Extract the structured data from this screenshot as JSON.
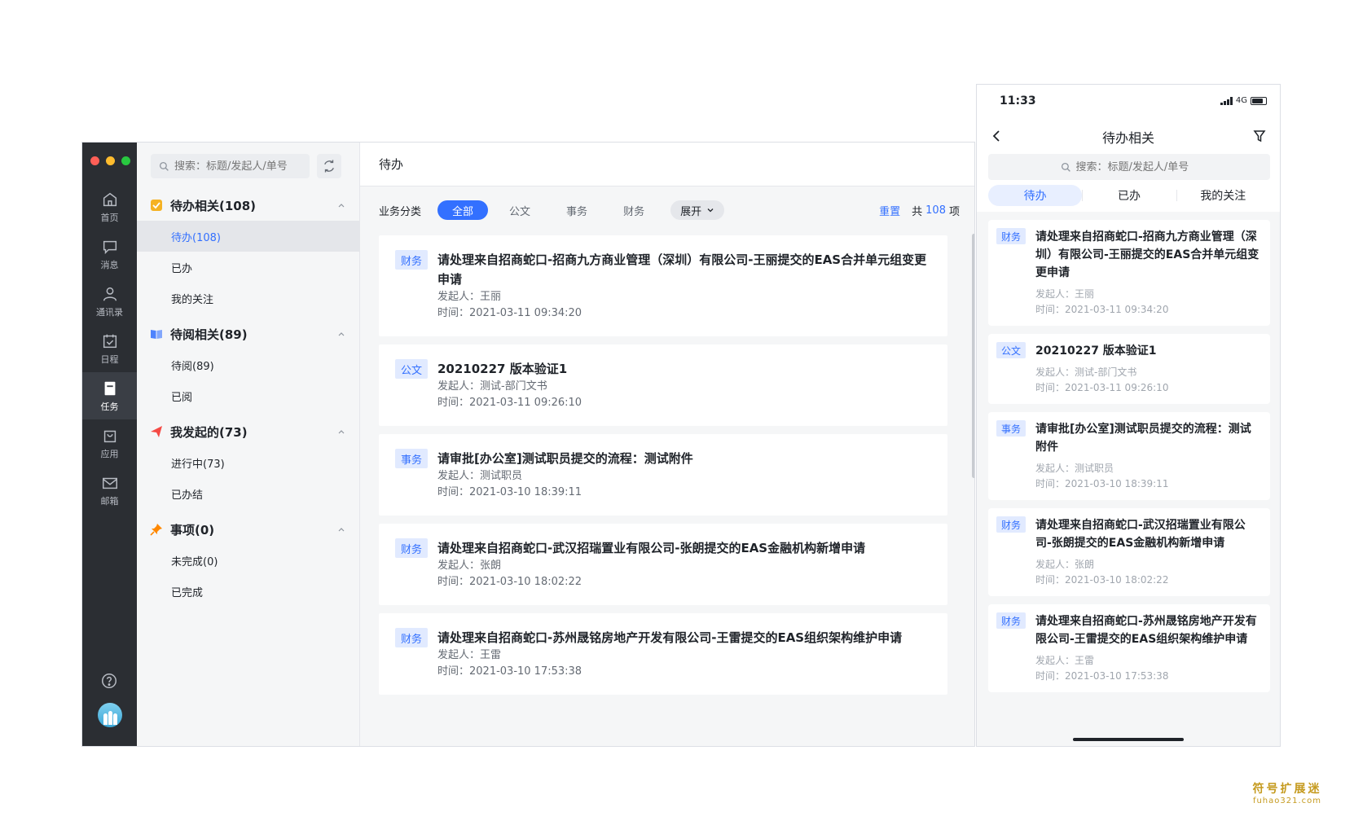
{
  "desktop": {
    "window_controls": {
      "close_color": "#ff5f57",
      "minimize_color": "#febc2e",
      "zoom_color": "#28c840"
    },
    "rail": [
      {
        "label": "首页",
        "icon": "home-icon"
      },
      {
        "label": "消息",
        "icon": "message-icon"
      },
      {
        "label": "通讯录",
        "icon": "contacts-icon"
      },
      {
        "label": "日程",
        "icon": "calendar-icon"
      },
      {
        "label": "任务",
        "icon": "task-icon",
        "active": true
      },
      {
        "label": "应用",
        "icon": "apps-icon"
      },
      {
        "label": "邮箱",
        "icon": "mail-icon"
      }
    ],
    "sidebar": {
      "search_placeholder": "搜索：标题/发起人/单号",
      "groups": [
        {
          "title": "待办相关(108)",
          "icon": "checkbox-icon",
          "items": [
            "待办(108)",
            "已办",
            "我的关注"
          ]
        },
        {
          "title": "待阅相关(89)",
          "icon": "book-icon",
          "items": [
            "待阅(89)",
            "已阅"
          ]
        },
        {
          "title": "我发起的(73)",
          "icon": "send-icon",
          "items": [
            "进行中(73)",
            "已办结"
          ]
        },
        {
          "title": "事项(0)",
          "icon": "pin-icon",
          "items": [
            "未完成(0)",
            "已完成"
          ]
        }
      ]
    },
    "main": {
      "title": "待办",
      "filter_label": "业务分类",
      "chips": [
        "全部",
        "公文",
        "事务",
        "财务"
      ],
      "expand_label": "展开",
      "reset_label": "重置",
      "total_prefix": "共",
      "total_count": "108",
      "total_suffix": "项",
      "tasks": [
        {
          "tag": "财务",
          "title": "请处理来自招商蛇口-招商九方商业管理（深圳）有限公司-王丽提交的EAS合并单元组变更申请",
          "initiator": "发起人：王丽",
          "time": "时间：2021-03-11 09:34:20"
        },
        {
          "tag": "公文",
          "title": "20210227 版本验证1",
          "initiator": "发起人：测试-部门文书",
          "time": "时间：2021-03-11 09:26:10"
        },
        {
          "tag": "事务",
          "title": "请审批[办公室]测试职员提交的流程：测试附件",
          "initiator": "发起人：测试职员",
          "time": "时间：2021-03-10 18:39:11"
        },
        {
          "tag": "财务",
          "title": "请处理来自招商蛇口-武汉招瑞置业有限公司-张朗提交的EAS金融机构新增申请",
          "initiator": "发起人：张朗",
          "time": "时间：2021-03-10 18:02:22"
        },
        {
          "tag": "财务",
          "title": "请处理来自招商蛇口-苏州晟铭房地产开发有限公司-王雷提交的EAS组织架构维护申请",
          "initiator": "发起人：王雷",
          "time": "时间：2021-03-10 17:53:38"
        }
      ]
    }
  },
  "phone": {
    "status_time": "11:33",
    "network": "4G",
    "title": "待办相关",
    "search_placeholder": "搜索：标题/发起人/单号",
    "tabs": [
      "待办",
      "已办",
      "我的关注"
    ],
    "cards": [
      {
        "tag": "财务",
        "title": "请处理来自招商蛇口-招商九方商业管理（深圳）有限公司-王丽提交的EAS合并单元组变更申请",
        "initiator": "发起人：王丽",
        "time": "时间：2021-03-11 09:34:20"
      },
      {
        "tag": "公文",
        "title": "20210227 版本验证1",
        "initiator": "发起人：测试-部门文书",
        "time": "时间：2021-03-11 09:26:10"
      },
      {
        "tag": "事务",
        "title": "请审批[办公室]测试职员提交的流程：测试附件",
        "initiator": "发起人：测试职员",
        "time": "时间：2021-03-10 18:39:11"
      },
      {
        "tag": "财务",
        "title": "请处理来自招商蛇口-武汉招瑞置业有限公司-张朗提交的EAS金融机构新增申请",
        "initiator": "发起人：张朗",
        "time": "时间：2021-03-10 18:02:22"
      },
      {
        "tag": "财务",
        "title": "请处理来自招商蛇口-苏州晟铭房地产开发有限公司-王雷提交的EAS组织架构维护申请",
        "initiator": "发起人：王雷",
        "time": "时间：2021-03-10 17:53:38"
      }
    ]
  },
  "watermark": {
    "line1": "符号扩展迷",
    "line2": "fuhao321.com"
  },
  "colors": {
    "accent": "#3370ff",
    "rail_bg": "#2b2e33",
    "tag_bg": "#e1eaff"
  }
}
